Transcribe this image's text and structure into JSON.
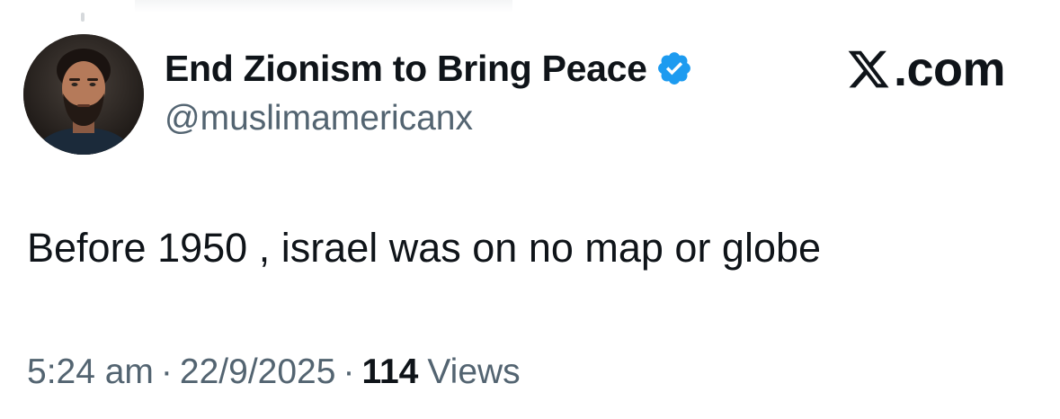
{
  "author": {
    "display_name": "End Zionism to Bring Peace",
    "handle": "@muslimamericanx",
    "verified": true,
    "verified_badge_color": "#1d9bf0"
  },
  "brand": {
    "domain": ".com",
    "icon": "x-logo-icon"
  },
  "tweet": {
    "text": "Before 1950 , israel was on no map or globe"
  },
  "meta": {
    "time": "5:24 am",
    "separator": "·",
    "date": "22/9/2025",
    "views_count": "114",
    "views_label": "Views"
  },
  "colors": {
    "text_primary": "#0f1419",
    "text_secondary": "#536471",
    "background": "#ffffff"
  }
}
